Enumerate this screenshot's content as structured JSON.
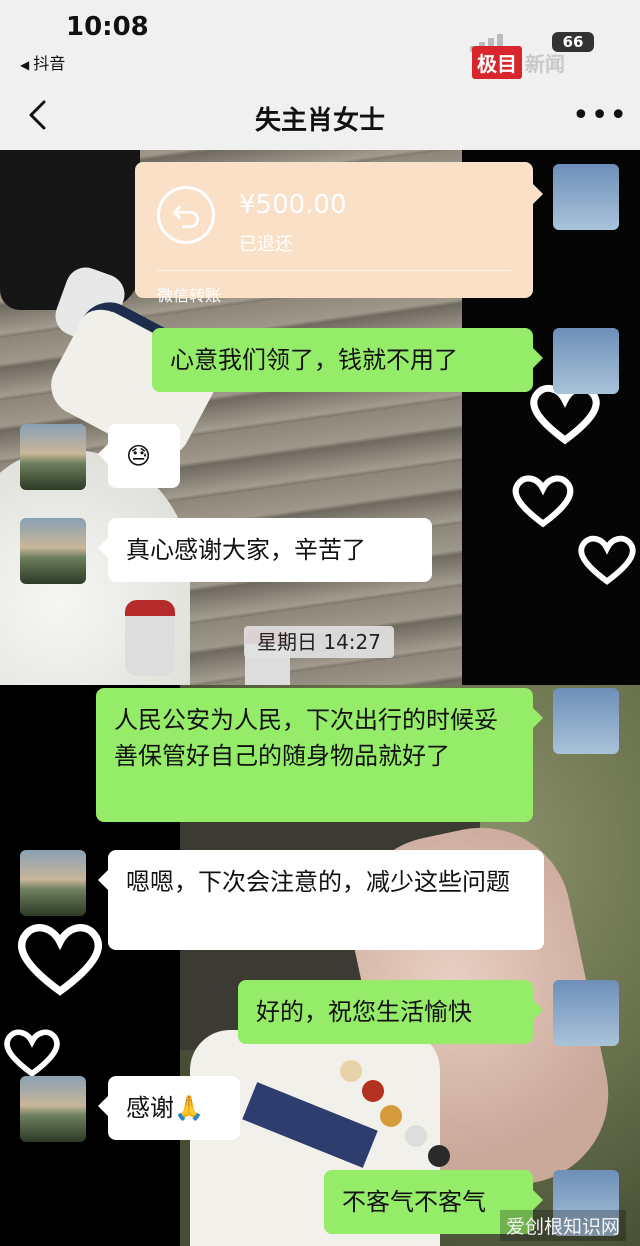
{
  "status_bar": {
    "time": "10:08",
    "back_app": "抖音",
    "battery": "66"
  },
  "watermark": {
    "badge": "极目",
    "text": "新闻"
  },
  "nav": {
    "title": "失主肖女士",
    "back_icon": "chevron-left-icon",
    "more_icon": "ellipsis-icon",
    "more_text": "•••"
  },
  "transfer": {
    "amount": "¥500.00",
    "status": "已退还",
    "label": "微信转账",
    "icon": "return-arrow-icon",
    "color": "#f9e0c6"
  },
  "messages": [
    {
      "side": "right",
      "text": "心意我们领了，钱就不用了"
    },
    {
      "side": "left",
      "text": "😓"
    },
    {
      "side": "left",
      "text": "真心感谢大家，辛苦了"
    },
    {
      "side": "right",
      "text": "人民公安为人民，下次出行的时候妥善保管好自己的随身物品就好了"
    },
    {
      "side": "left",
      "text": "嗯嗯，下次会注意的，减少这些问题"
    },
    {
      "side": "right",
      "text": "好的，祝您生活愉快"
    },
    {
      "side": "left",
      "text": "感谢🙏"
    },
    {
      "side": "right",
      "text": "不客气不客气"
    }
  ],
  "timestamp": "星期日 14:27",
  "site_watermark": "爱创根知识网",
  "colors": {
    "sent_bubble": "#95ec69",
    "received_bubble": "#ffffff",
    "nav_bg": "#f0f0f0"
  }
}
